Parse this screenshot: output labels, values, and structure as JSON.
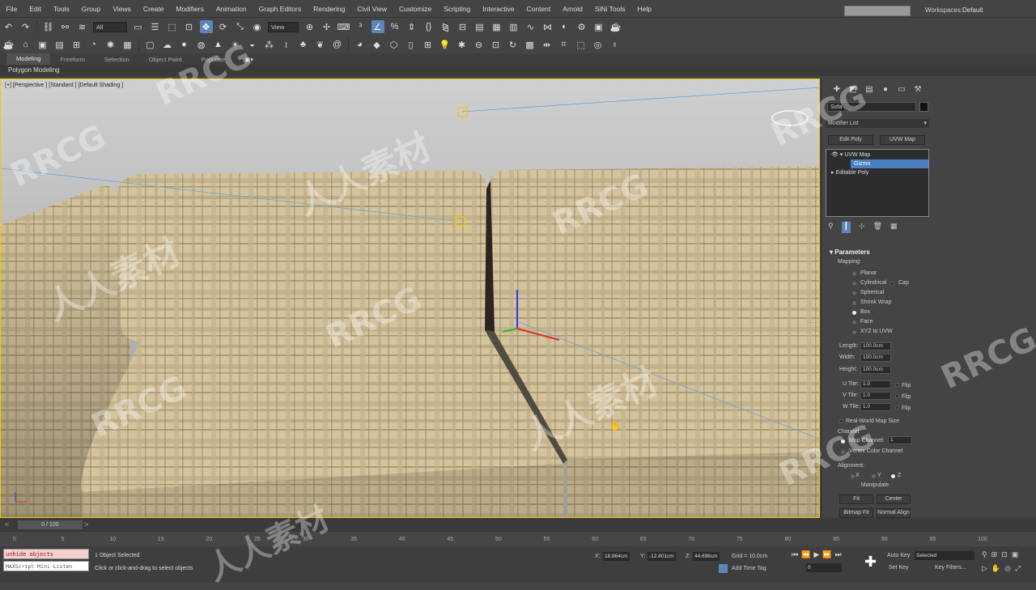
{
  "menu": [
    "File",
    "Edit",
    "Tools",
    "Group",
    "Views",
    "Create",
    "Modifiers",
    "Animation",
    "Graph Editors",
    "Rendering",
    "Civil View",
    "Customize",
    "Scripting",
    "Interactive",
    "Content",
    "Arnold",
    "SiNi Tools",
    "Help"
  ],
  "workspace": {
    "label": "Workspaces:",
    "value": "Default"
  },
  "toolbar": {
    "selection_filter": "All",
    "ref_coord": "View"
  },
  "ribbon": {
    "tabs": [
      "Modeling",
      "Freeform",
      "Selection",
      "Object Paint",
      "Populate"
    ],
    "active": "Modeling",
    "subtitle": "Polygon Modeling"
  },
  "viewport": {
    "label": "[+] [Perspective ] [Standard ] [Default Shading ]",
    "fabric_color": "#d2c29b",
    "bg_color": "#bdbdbd"
  },
  "command_panel": {
    "object_name": "Sofa",
    "modifier_list": "Modifier List",
    "buttons": [
      "Edit Poly",
      "UVW Map"
    ],
    "stack": [
      {
        "label": "UVW Map",
        "expanded": true
      },
      {
        "label": "Gizmo",
        "selected": true
      },
      {
        "label": "Editable Poly",
        "expanded": false
      }
    ],
    "params": {
      "title": "Parameters",
      "mapping_label": "Mapping:",
      "mapping_options": [
        "Planar",
        "Cylindrical",
        "Spherical",
        "Shrink Wrap",
        "Box",
        "Face",
        "XYZ to UVW"
      ],
      "cap_label": "Cap",
      "selected_mapping": "Box",
      "dims": [
        {
          "label": "Length:",
          "value": "100.0cm"
        },
        {
          "label": "Width:",
          "value": "100.0cm"
        },
        {
          "label": "Height:",
          "value": "100.0cm"
        }
      ],
      "tiles": [
        {
          "label": "U Tile:",
          "value": "1.0"
        },
        {
          "label": "V Tile:",
          "value": "1.0"
        },
        {
          "label": "W Tile:",
          "value": "1.0"
        }
      ],
      "flip": "Flip",
      "real_world": "Real-World Map Size",
      "channel_label": "Channel:",
      "map_channel_label": "Map Channel:",
      "map_channel": "1",
      "vertex_color": "Vertex Color Channel",
      "alignment_label": "Alignment:",
      "axes": [
        "X",
        "Y",
        "Z"
      ],
      "selected_axis": "Z",
      "manipulate": "Manipulate",
      "fit": "Fit",
      "center": "Center",
      "bitmap_fit": "Bitmap Fit",
      "normal_align": "Normal Align"
    }
  },
  "timeline": {
    "slider": "0 / 100",
    "ticks": [
      "0",
      "5",
      "10",
      "15",
      "20",
      "25",
      "30",
      "35",
      "40",
      "45",
      "50",
      "55",
      "60",
      "65",
      "70",
      "75",
      "80",
      "85",
      "90",
      "95",
      "100"
    ]
  },
  "status": {
    "maxscript1": "unhide objects",
    "maxscript2": "MAXScript Mini Listen",
    "selected": "1 Object Selected",
    "prompt": "Click or click-and-drag to select objects",
    "x": "18.864cm",
    "y": "-12.801cm",
    "z": "44.696cm",
    "grid": "Grid = 10.0cm",
    "add_time_tag": "Add Time Tag",
    "auto_key": "Auto Key",
    "set_key": "Set Key",
    "key_mode": "Selected",
    "key_filters": "Key Filters...",
    "frame": "0"
  },
  "watermarks": [
    "RRCG",
    "人人素材"
  ]
}
